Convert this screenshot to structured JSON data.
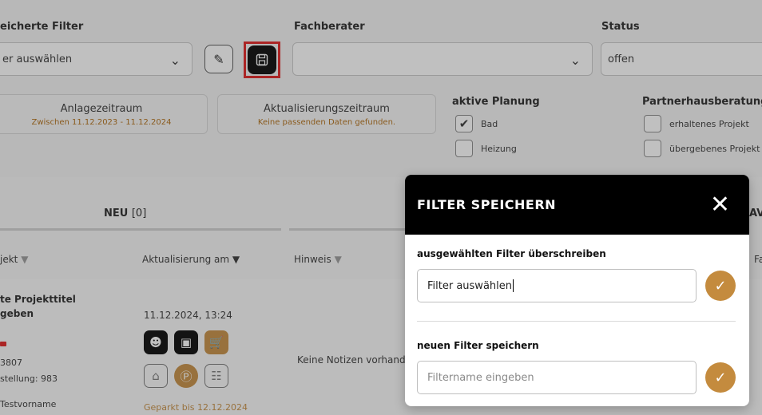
{
  "filters": {
    "saved_filter_label": "eicherte Filter",
    "saved_filter_value": "er auswählen",
    "advisor_label": "Fachberater",
    "advisor_value": "",
    "status_label": "Status",
    "status_value": "offen"
  },
  "ranges": [
    {
      "title": "Anlagezeitraum",
      "subtitle": "Zwischen 11.12.2023 - 11.12.2024"
    },
    {
      "title": "Aktualisierungszeitraum",
      "subtitle": "Keine passenden Daten gefunden."
    }
  ],
  "planning": {
    "heading": "aktive Planung",
    "options": [
      {
        "label": "Bad",
        "checked": true
      },
      {
        "label": "Heizung",
        "checked": false
      }
    ]
  },
  "partner": {
    "heading": "Partnerhausberatung",
    "options": [
      {
        "label": "erhaltenes Projekt",
        "checked": false
      },
      {
        "label": "übergebenes Projekt",
        "checked": false
      }
    ]
  },
  "table": {
    "tab_new": "NEU",
    "tab_new_count": "[0]",
    "tab_right_partial": "AV",
    "col_project": "jekt",
    "col_updated": "Aktualisierung am",
    "col_note": "Hinweis",
    "col_right_partial": "Fa",
    "row": {
      "title_line1": "te Projekttitel",
      "title_line2": "geben",
      "updated": "11.12.2024, 13:24",
      "meta1": "3807",
      "meta2": "stellung: 983",
      "meta3": "Testvorname",
      "note": "Keine Notizen vorhand",
      "parked": "Geparkt bis 12.12.2024"
    }
  },
  "modal": {
    "title": "FILTER SPEICHERN",
    "overwrite_label": "ausgewählten Filter überschreiben",
    "overwrite_value": "Filter auswählen",
    "new_label": "neuen Filter speichern",
    "new_placeholder": "Filtername eingeben"
  },
  "colors": {
    "accent_gold": "#c48b3e",
    "highlight_red": "#e01b1b",
    "modal_header": "#000000"
  }
}
